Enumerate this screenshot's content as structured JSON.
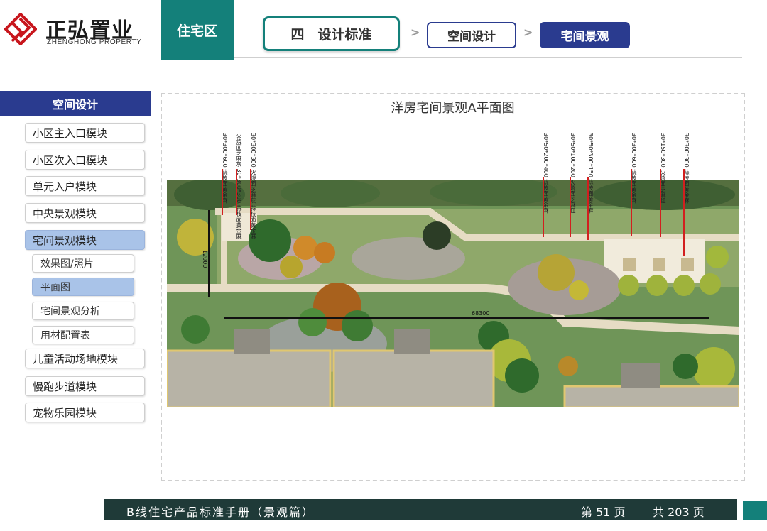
{
  "brand": {
    "name_cn": "正弘置业",
    "name_en": "ZHENGHONG PROPERTY"
  },
  "zone_tab": "住宅区",
  "breadcrumb": {
    "section": "四　设计标准",
    "sep": ">",
    "category": "空间设计",
    "current": "宅间景观"
  },
  "sidebar": {
    "header": "空间设计",
    "items": [
      {
        "label": "小区主入口模块"
      },
      {
        "label": "小区次入口模块"
      },
      {
        "label": "单元入户模块"
      },
      {
        "label": "中央景观模块"
      },
      {
        "label": "宅间景观模块"
      },
      {
        "label": "效果图/照片"
      },
      {
        "label": "平面图"
      },
      {
        "label": "宅间景观分析"
      },
      {
        "label": "用材配置表"
      },
      {
        "label": "儿童活动场地模块"
      },
      {
        "label": "慢跑步道模块"
      },
      {
        "label": "宠物乐园模块"
      }
    ]
  },
  "plan": {
    "title": "洋房宅间景观A平面图",
    "callouts": [
      "30*300*600 蒜枝面黄金麻",
      "火烧面芝麻灰 30*300*300 蒜枝面黄金麻",
      "30*300*300 火烧面芝麻灰 蒜枝面黄金麻",
      "30*50*200*400 蒜枝面黄金麻",
      "30*50*100*200 火烧面芝麻红",
      "30*50*300*150 蒜枝面黄金麻",
      "30*300*600 蒜枝面黄金麻",
      "30*150*300 火烧面芝麻红",
      "30*300*300 蒜枝面黄金麻"
    ],
    "dim_vertical": "12000",
    "dim_horizontal": "68300"
  },
  "footer": {
    "title": "B线住宅产品标准手册（景观篇）",
    "page": "第 51 页",
    "total": "共 203 页"
  },
  "colors": {
    "teal": "#14807a",
    "navy": "#2a3b8f",
    "sidebar_active": "#a9c3e8",
    "footer": "#1f3a38"
  }
}
